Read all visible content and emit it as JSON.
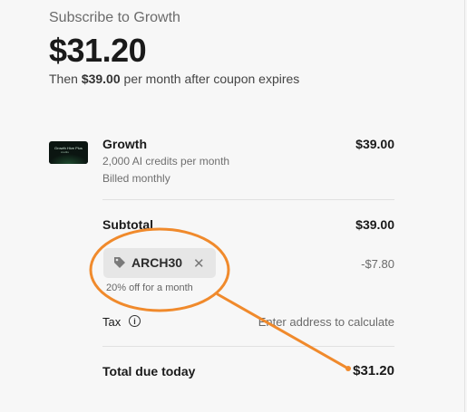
{
  "header": {
    "subscribe_title": "Subscribe to Growth",
    "price": "$31.20",
    "then_prefix": "Then ",
    "then_amount": "$39.00",
    "then_suffix": " per month after coupon expires"
  },
  "line_item": {
    "thumbnail_text_1": "Growth Hive Plus",
    "thumbnail_text_2": "credits",
    "name": "Growth",
    "description": "2,000 AI credits per month",
    "billing": "Billed monthly",
    "price": "$39.00"
  },
  "summary": {
    "subtotal_label": "Subtotal",
    "subtotal_value": "$39.00",
    "coupon_code": "ARCH30",
    "coupon_note": "20% off for a month",
    "discount_value": "-$7.80",
    "tax_label": "Tax",
    "tax_value": "Enter address to calculate",
    "total_label": "Total due today",
    "total_value": "$31.20"
  },
  "icons": {
    "tag": "tag-icon",
    "close": "close-icon",
    "info": "info-icon"
  },
  "colors": {
    "annotation": "#f08a2c",
    "background": "#f7f7f7",
    "coupon_bg": "#e6e6e6"
  }
}
